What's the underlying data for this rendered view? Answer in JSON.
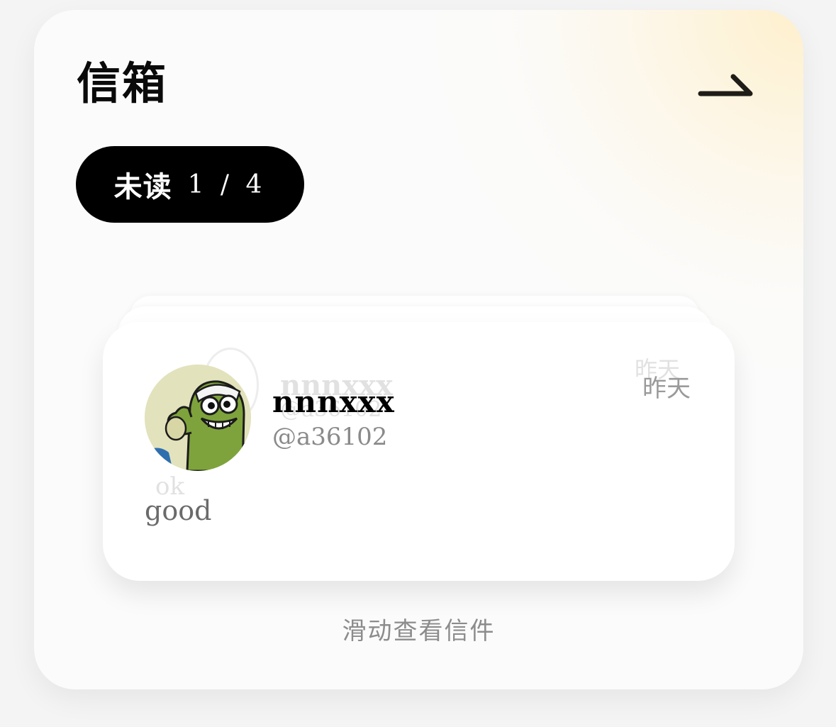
{
  "inbox": {
    "title": "信箱",
    "arrow_icon": "arrow-right-icon",
    "accent_bg": "#fbfbfb",
    "glow_color": "#ffecbe"
  },
  "unread": {
    "label": "未读",
    "count": "1 / 4",
    "current": 1,
    "total": 4
  },
  "letter": {
    "sender_name": "nnnxxx",
    "handle": "@a36102",
    "time": "昨天",
    "message": "good"
  },
  "next_letter": {
    "sender_name": "nnnxxx",
    "handle": "@a36102",
    "time": "昨天",
    "message": "ok"
  },
  "hint": "滑动查看信件"
}
